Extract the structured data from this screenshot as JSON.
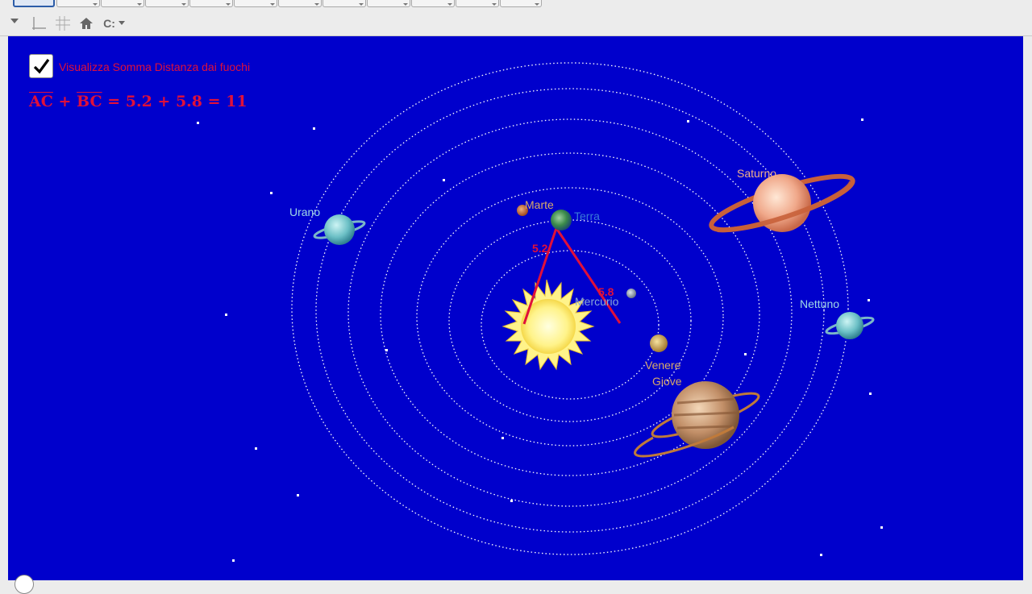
{
  "toolbar": {
    "tools": [
      "move",
      "point",
      "line",
      "perpendicular",
      "polygon",
      "circle",
      "ellipse",
      "angle",
      "reflect",
      "slider",
      "zoom"
    ]
  },
  "stylebar": {
    "items": [
      "axes",
      "grid",
      "home",
      "label-style"
    ],
    "label_style": "C:"
  },
  "canvas": {
    "background": "#0000cc",
    "checkbox_label": "Visualizza Somma Distanza dai fuochi",
    "checkbox_checked": true,
    "formula": {
      "seg1": "AC",
      "plus": "+",
      "seg2": "BC",
      "rest": "= 5.2 + 5.8 = 11"
    },
    "distance_labels": [
      "5.2",
      "5.8"
    ],
    "planets": {
      "mercurio": "Mercurio",
      "venere": "Venere",
      "terra": "Terra",
      "marte": "Marte",
      "giove": "Giove",
      "saturno": "Saturno",
      "urano": "Urano",
      "nettuno": "Nettuno"
    }
  },
  "colors": {
    "accent_red": "#e0103a",
    "orbit": "#ffffff",
    "sun": "#fff38a"
  }
}
